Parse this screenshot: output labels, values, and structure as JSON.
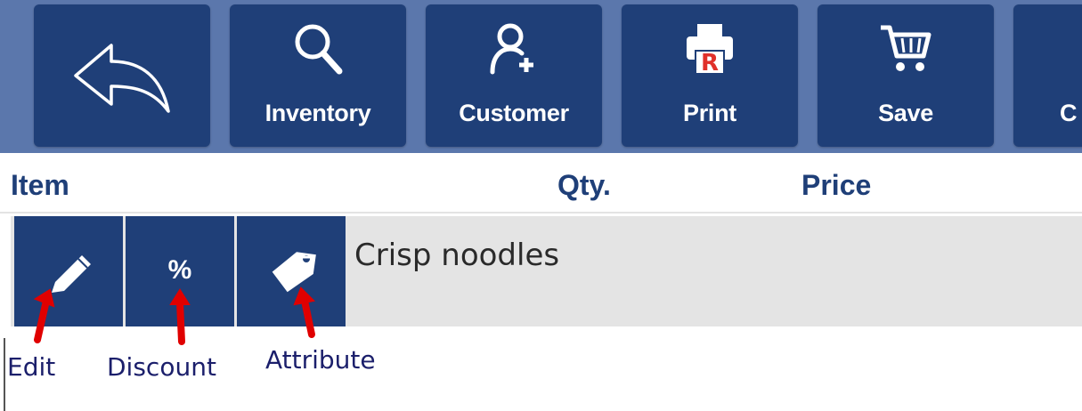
{
  "toolbar": {
    "buttons": [
      {
        "id": "back",
        "label": "",
        "icon": "back-arrow-icon"
      },
      {
        "id": "inventory",
        "label": "Inventory",
        "icon": "search-icon"
      },
      {
        "id": "customer",
        "label": "Customer",
        "icon": "add-user-icon"
      },
      {
        "id": "print",
        "label": "Print",
        "icon": "printer-icon"
      },
      {
        "id": "save",
        "label": "Save",
        "icon": "cart-icon"
      },
      {
        "id": "partial",
        "label": "C",
        "icon": "partial-icon"
      }
    ]
  },
  "columns": {
    "item": "Item",
    "qty": "Qty.",
    "price": "Price"
  },
  "item_row": {
    "name": "Crisp noodles",
    "actions": [
      {
        "id": "edit",
        "icon": "pencil-icon",
        "label": ""
      },
      {
        "id": "discount",
        "icon": "percent-icon",
        "label": "%"
      },
      {
        "id": "attribute",
        "icon": "tag-icon",
        "label": ""
      }
    ]
  },
  "callouts": {
    "edit": "Edit",
    "discount": "Discount",
    "attribute": "Attribute"
  },
  "colors": {
    "toolbar_bg": "#5b77ac",
    "button_bg": "#1f3f78",
    "row_bg": "#e4e4e4",
    "arrow": "#e00000",
    "callout_text": "#1b1f6b"
  }
}
